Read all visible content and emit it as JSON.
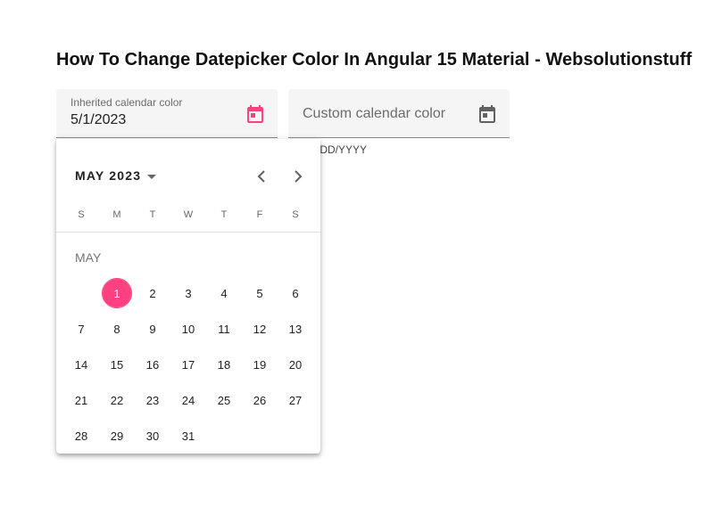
{
  "page": {
    "title": "How To Change Datepicker Color In Angular 15 Material - Websolutionstuff"
  },
  "fields": {
    "inherited": {
      "label": "Inherited calendar color",
      "value": "5/1/2023",
      "icon": "calendar-icon",
      "icon_color": "#ff4081"
    },
    "custom": {
      "placeholder": "Custom calendar color",
      "hint": "MM/DD/YYYY",
      "visible_hint": "/DD/YYYY",
      "icon": "calendar-icon",
      "icon_color": "#616161"
    }
  },
  "calendar": {
    "period_label": "MAY 2023",
    "prev_icon": "chevron-left-icon",
    "next_icon": "chevron-right-icon",
    "weekdays": [
      "S",
      "M",
      "T",
      "W",
      "T",
      "F",
      "S"
    ],
    "month_label": "MAY",
    "selected_day": 1,
    "accent_color": "#ff4081",
    "weeks": [
      [
        "",
        "1",
        "2",
        "3",
        "4",
        "5",
        "6"
      ],
      [
        "7",
        "8",
        "9",
        "10",
        "11",
        "12",
        "13"
      ],
      [
        "14",
        "15",
        "16",
        "17",
        "18",
        "19",
        "20"
      ],
      [
        "21",
        "22",
        "23",
        "24",
        "25",
        "26",
        "27"
      ],
      [
        "28",
        "29",
        "30",
        "31",
        "",
        "",
        ""
      ]
    ]
  }
}
